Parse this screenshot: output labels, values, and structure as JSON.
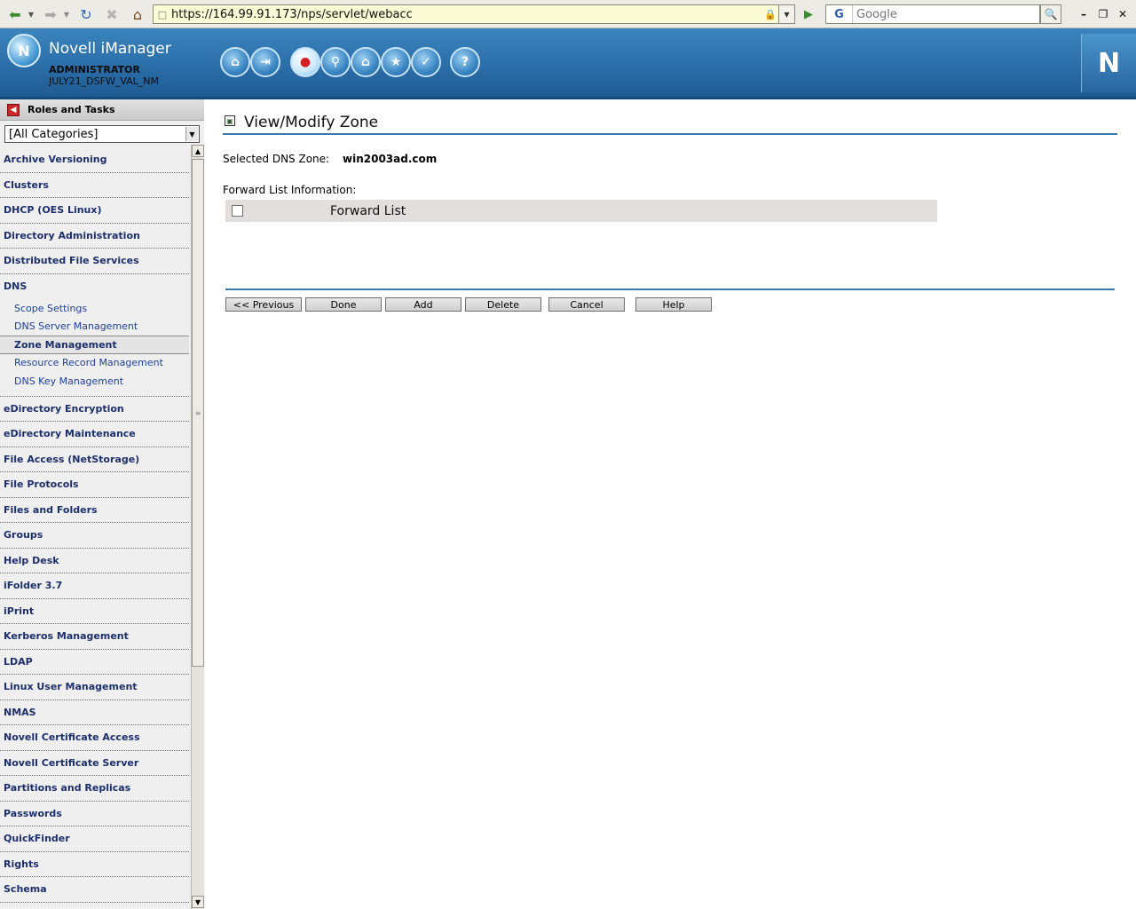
{
  "browser": {
    "url": "https://164.99.91.173/nps/servlet/webacc",
    "search_placeholder": "Google",
    "search_engine_glyph": "G"
  },
  "header": {
    "app_title": "Novell iManager",
    "user": "ADMINISTRATOR",
    "tree": "JULY21_DSFW_VAL_NM",
    "brand_letter": "N",
    "toolbar_icons": [
      "home-icon",
      "exit-icon",
      "roles-tasks-icon",
      "view-objects-icon",
      "configure-icon",
      "favorites-icon",
      "preferences-icon",
      "help-icon"
    ],
    "active_tool": "roles-tasks-icon"
  },
  "sidebar": {
    "title": "Roles and Tasks",
    "category_select": "[All Categories]",
    "categories_before_dns": [
      "Archive Versioning",
      "Clusters",
      "DHCP (OES Linux)",
      "Directory Administration",
      "Distributed File Services"
    ],
    "dns": {
      "label": "DNS",
      "tasks": [
        "Scope Settings",
        "DNS Server Management",
        "Zone Management",
        "Resource Record Management",
        "DNS Key Management"
      ],
      "selected_task": "Zone Management"
    },
    "categories_after_dns": [
      "eDirectory Encryption",
      "eDirectory Maintenance",
      "File Access (NetStorage)",
      "File Protocols",
      "Files and Folders",
      "Groups",
      "Help Desk",
      "iFolder 3.7",
      "iPrint",
      "Kerberos Management",
      "LDAP",
      "Linux User Management",
      "NMAS",
      "Novell Certificate Access",
      "Novell Certificate Server",
      "Partitions and Replicas",
      "Passwords",
      "QuickFinder",
      "Rights",
      "Schema"
    ]
  },
  "main": {
    "title": "View/Modify Zone",
    "zone_label": "Selected DNS Zone:",
    "zone_value": "win2003ad.com",
    "forward_info_label": "Forward List Information:",
    "forward_table_header": "Forward List",
    "buttons": {
      "previous": "<< Previous",
      "done": "Done",
      "add": "Add",
      "delete": "Delete",
      "cancel": "Cancel",
      "help": "Help"
    }
  },
  "colors": {
    "header_blue": "#2b6ea9",
    "rule_blue": "#3a78ad",
    "link_blue": "#1c3f99",
    "category_navy": "#1c2f6b",
    "table_header_bg": "#e1dedb"
  }
}
